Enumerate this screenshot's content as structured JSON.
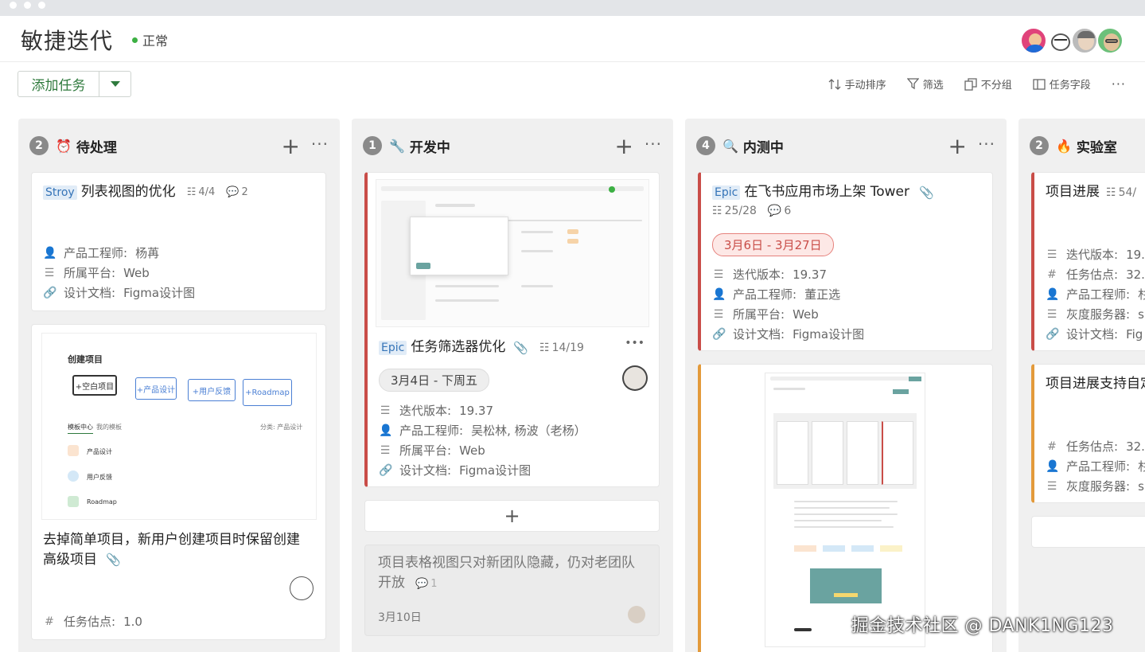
{
  "header": {
    "title": "敏捷迭代",
    "status": "正常"
  },
  "toolbar": {
    "add_task": "添加任务",
    "sort": "手动排序",
    "filter": "筛选",
    "group": "不分组",
    "fields": "任务字段",
    "more": "···"
  },
  "columns": [
    {
      "count": "2",
      "icon": "⏰",
      "title": "待处理",
      "plus": "+",
      "more": "···"
    },
    {
      "count": "1",
      "icon": "🔧",
      "title": "开发中",
      "plus": "+",
      "more": "···"
    },
    {
      "count": "4",
      "icon": "🔍",
      "title": "内测中",
      "plus": "+",
      "more": "···"
    },
    {
      "count": "2",
      "icon": "🔥",
      "title": "实验室",
      "plus": "+",
      "more": "···"
    }
  ],
  "col1": {
    "card1": {
      "tag": "Stroy",
      "title": "列表视图的优化",
      "subtasks": "4/4",
      "comments": "2",
      "f1k": "产品工程师:",
      "f1v": "杨苒",
      "f2k": "所属平台:",
      "f2v": "Web",
      "f3k": "设计文档:",
      "f3v": "Figma设计图"
    },
    "card2": {
      "sketch_title": "创建项目",
      "sketch_boxes": [
        "+空白项目",
        "+产品设计",
        "+用户反馈",
        "+Roadmap"
      ],
      "tab1": "模板中心",
      "tab2": "我的模板",
      "cat": "分类: 产品设计",
      "items": [
        "产品设计",
        "用户反馈",
        "Roadmap"
      ],
      "title": "去掉简单项目，新用户创建项目时保留创建高级项目",
      "f1k": "任务估点:",
      "f1v": "1.0"
    }
  },
  "col2": {
    "card1": {
      "tag": "Epic",
      "title": "任务筛选器优化",
      "subtasks": "14/19",
      "more": "•••",
      "date": "3月4日 - 下周五",
      "f1k": "迭代版本:",
      "f1v": "19.37",
      "f2k": "产品工程师:",
      "f2v": "吴松林, 杨波（老杨）",
      "f3k": "所属平台:",
      "f3v": "Web",
      "f4k": "设计文档:",
      "f4v": "Figma设计图"
    },
    "add": "+",
    "card2": {
      "title": "项目表格视图只对新团队隐藏，仍对老团队开放",
      "comments": "1",
      "date": "3月10日"
    }
  },
  "col3": {
    "card1": {
      "tag": "Epic",
      "title": "在飞书应用市场上架 Tower",
      "subtasks": "25/28",
      "comments": "6",
      "date": "3月6日 - 3月27日",
      "f1k": "迭代版本:",
      "f1v": "19.37",
      "f2k": "产品工程师:",
      "f2v": "董正选",
      "f3k": "所属平台:",
      "f3v": "Web",
      "f4k": "设计文档:",
      "f4v": "Figma设计图"
    }
  },
  "col4": {
    "card1": {
      "title": "项目进展",
      "subtasks": "54/",
      "f1k": "迭代版本:",
      "f1v": "19.",
      "f2k": "任务估点:",
      "f2v": "32.",
      "f3k": "产品工程师:",
      "f3v": "杉",
      "f4k": "灰度服务器:",
      "f4v": "s",
      "f5k": "设计文档:",
      "f5v": "Fig"
    },
    "card2": {
      "title": "项目进展支持自定",
      "f1k": "任务估点:",
      "f1v": "32.",
      "f2k": "产品工程师:",
      "f2v": "杉",
      "f3k": "灰度服务器:",
      "f3v": "s"
    }
  },
  "watermark": "掘金技术社区 @ DANK1NG123"
}
